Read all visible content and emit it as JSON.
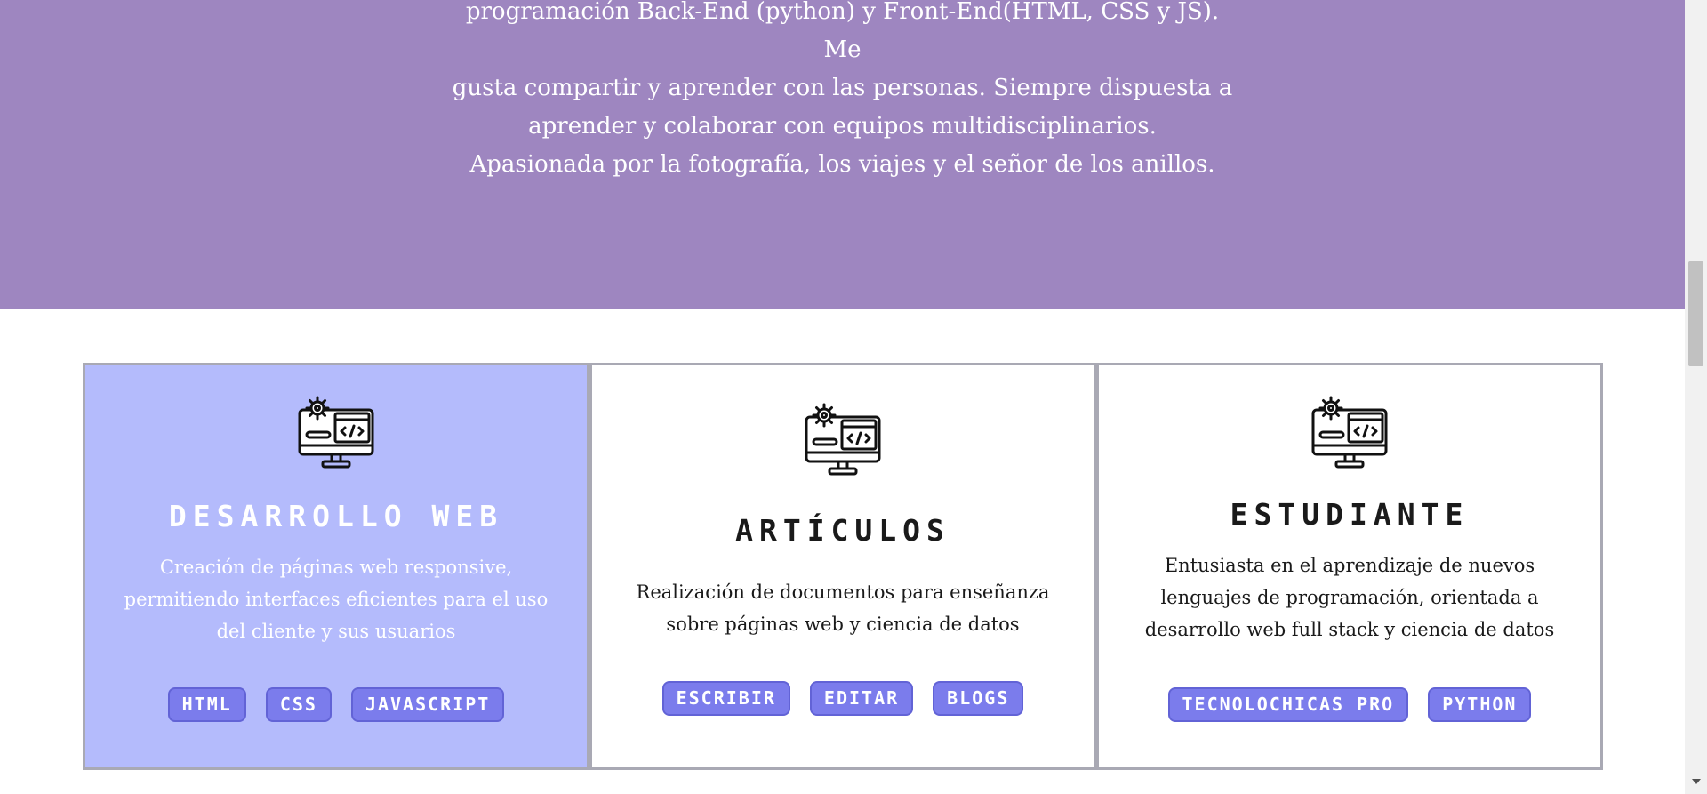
{
  "hero": {
    "lines": [
      "programación Back-End (python) y Front-End(HTML, CSS y JS). Me",
      "gusta compartir y aprender con las personas. Siempre dispuesta a",
      "aprender y colaborar con equipos multidisciplinarios.",
      "Apasionada por la fotografía, los viajes y el señor de los anillos."
    ]
  },
  "cards": [
    {
      "icon": "computer-code-gear-icon",
      "title": "DESARROLLO WEB",
      "description": "Creación de páginas web responsive, permitiendo interfaces eficientes para el uso del cliente y sus usuarios",
      "tags": [
        "HTML",
        "CSS",
        "JAVASCRIPT"
      ]
    },
    {
      "icon": "computer-code-gear-icon",
      "title": "ARTÍCULOS",
      "description": "Realización de documentos para enseñanza sobre páginas web y ciencia de datos",
      "tags": [
        "ESCRIBIR",
        "EDITAR",
        "BLOGS"
      ]
    },
    {
      "icon": "computer-code-gear-icon",
      "title": "ESTUDIANTE",
      "description": "Entusiasta en el aprendizaje de nuevos lenguajes de programación, orientada a desarrollo web full stack y ciencia de datos",
      "tags": [
        "TECNOLOCHICAS PRO",
        "PYTHON"
      ]
    }
  ],
  "colors": {
    "hero_bg": "#9e86c0",
    "active_card_bg": "#b4bbfc",
    "tag_bg": "#7b7cec",
    "card_border": "#a9a9b4"
  }
}
